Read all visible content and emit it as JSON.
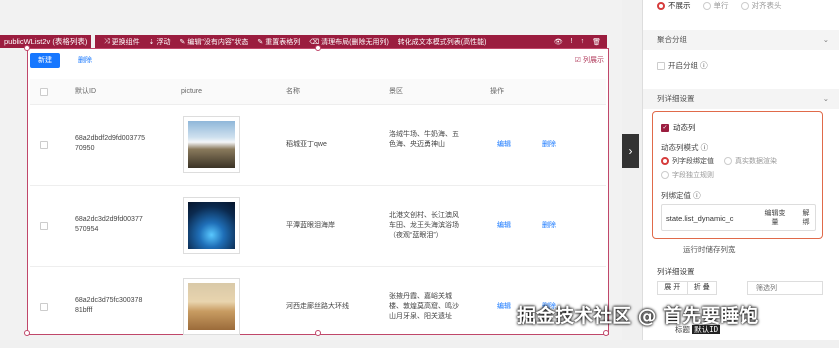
{
  "component": {
    "tag": "publicWList2v (表格列表)"
  },
  "toolbar": {
    "items": [
      {
        "icon": "⤨",
        "label": "更换组件"
      },
      {
        "icon": "⇣",
        "label": "浮动"
      },
      {
        "icon": "✎",
        "label": "编辑\"没有内容\"状态"
      },
      {
        "icon": "✎",
        "label": "重置表格列"
      },
      {
        "icon": "⌫",
        "label": "清理布局(删除无用列)"
      },
      {
        "icon": "",
        "label": "转化成文本模式列表(高性能)"
      }
    ],
    "tail_icons": [
      "eye-icon",
      "info-icon",
      "up-arrow-icon",
      "trash-icon"
    ]
  },
  "table": {
    "new_label": "新建",
    "delete_label": "删除",
    "column_show": "列展示",
    "headers": {
      "id": "默认ID",
      "picture": "picture",
      "name": "名称",
      "scenic": "景区",
      "op": "操作"
    },
    "edit_label": "编辑",
    "remove_label": "删除",
    "rows": [
      {
        "id_line1": "68a2dbdf2d9fd003775",
        "id_line2": "70950",
        "name": "稻城亚丁qwe",
        "scenic_l1": "洛绒牛场、牛奶海、五",
        "scenic_l2": "色海、央迈勇神山",
        "scenic_l3": ""
      },
      {
        "id_line1": "68a2dc3d2d9fd00377",
        "id_line2": "570954",
        "name": "平潭蓝眼泪海岸",
        "scenic_l1": "北港文创村、长江澳风",
        "scenic_l2": "车田、龙王头海滨浴场",
        "scenic_l3": "（夜观“蓝眼泪”）"
      },
      {
        "id_line1": "68a2dc3d75fc300378",
        "id_line2": "81bfff",
        "name": "河西走廊丝路大环线",
        "scenic_l1": "张掖丹霞、嘉峪关城",
        "scenic_l2": "楼、敦煌莫高窟、鸣沙",
        "scenic_l3": "山月牙泉、阳关遗址"
      }
    ]
  },
  "panel": {
    "top_radio": [
      "不展示",
      "单行",
      "对齐表头"
    ],
    "aggregate_title": "聚合分组",
    "aggregate_toggle": "开启分组",
    "col_settings_title": "列详细设置",
    "dynamic_col": "动态列",
    "dynamic_mode_label": "动态列模式",
    "modes": [
      "列字段绑定值",
      "真实数据渲染",
      "字段独立规则"
    ],
    "bind_label": "列绑定值",
    "bind_value": "state.list_dynamic_c",
    "edit_var_l1": "编辑变",
    "edit_var_l2": "量",
    "unbind_l1": "解",
    "unbind_l2": "绑",
    "runtime_store": "运行时储存列宽",
    "col_detail": "列详细设置",
    "expand": "展 开",
    "collapse": "折 叠",
    "filter_placeholder": "筛选列",
    "bottom_title": "标题",
    "bottom_value": "默认ID"
  },
  "watermark": "掘金技术社区 @ 首先要睡饱",
  "colors": {
    "accent": "#9b1d3f",
    "primary": "#1677ff",
    "highlight": "#e06a4a"
  }
}
